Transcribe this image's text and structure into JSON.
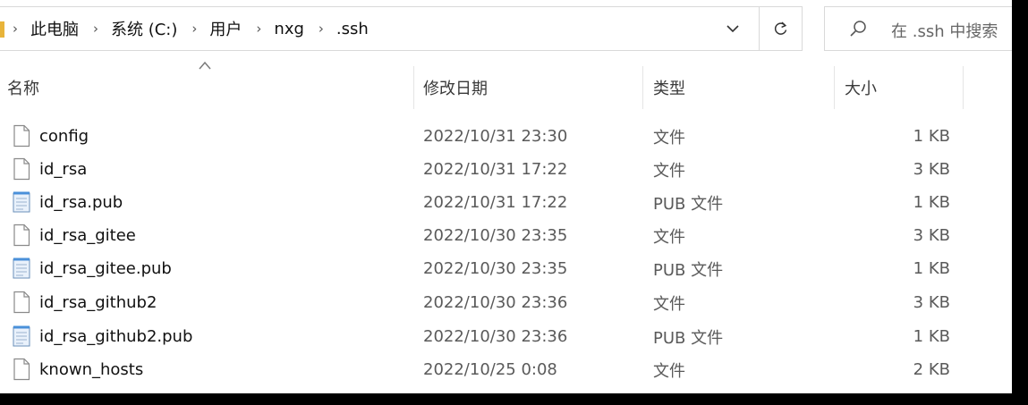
{
  "address_bar": {
    "breadcrumbs": [
      "此电脑",
      "系统 (C:)",
      "用户",
      "nxg",
      ".ssh"
    ],
    "separator": "›"
  },
  "search": {
    "placeholder": "在 .ssh 中搜索"
  },
  "columns": {
    "name": "名称",
    "date": "修改日期",
    "type": "类型",
    "size": "大小"
  },
  "files": [
    {
      "name": "config",
      "date": "2022/10/31 23:30",
      "type": "文件",
      "size": "1 KB",
      "icon": "blank-file-icon"
    },
    {
      "name": "id_rsa",
      "date": "2022/10/31 17:22",
      "type": "文件",
      "size": "3 KB",
      "icon": "blank-file-icon"
    },
    {
      "name": "id_rsa.pub",
      "date": "2022/10/31 17:22",
      "type": "PUB 文件",
      "size": "1 KB",
      "icon": "notepad-file-icon"
    },
    {
      "name": "id_rsa_gitee",
      "date": "2022/10/30 23:35",
      "type": "文件",
      "size": "3 KB",
      "icon": "blank-file-icon"
    },
    {
      "name": "id_rsa_gitee.pub",
      "date": "2022/10/30 23:35",
      "type": "PUB 文件",
      "size": "1 KB",
      "icon": "notepad-file-icon"
    },
    {
      "name": "id_rsa_github2",
      "date": "2022/10/30 23:36",
      "type": "文件",
      "size": "3 KB",
      "icon": "blank-file-icon"
    },
    {
      "name": "id_rsa_github2.pub",
      "date": "2022/10/30 23:36",
      "type": "PUB 文件",
      "size": "1 KB",
      "icon": "notepad-file-icon"
    },
    {
      "name": "known_hosts",
      "date": "2022/10/25 0:08",
      "type": "文件",
      "size": "2 KB",
      "icon": "blank-file-icon"
    }
  ],
  "colors": {
    "folder_accent": "#e8b43a",
    "notepad_blue": "#4a90d9",
    "border": "#d9d9d9"
  }
}
